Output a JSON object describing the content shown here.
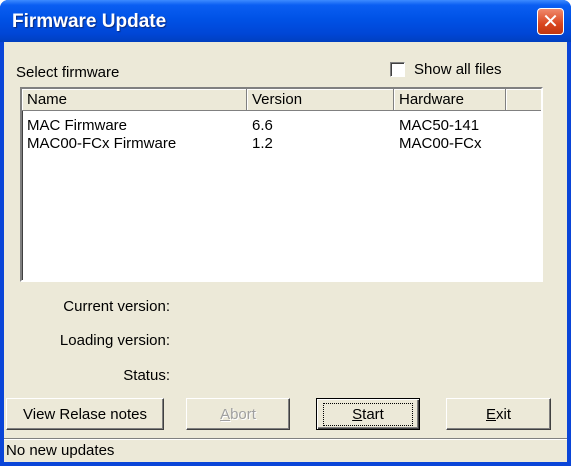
{
  "window": {
    "title": "Firmware Update",
    "close_glyph": "✕"
  },
  "select_firmware_label": "Select firmware",
  "show_all_files": {
    "label": "Show all files",
    "checked": false
  },
  "firmware_list": {
    "columns": [
      "Name",
      "Version",
      "Hardware",
      ""
    ],
    "rows": [
      {
        "name": "MAC Firmware",
        "version": "6.6",
        "hardware": "MAC50-141"
      },
      {
        "name": "MAC00-FCx Firmware",
        "version": "1.2",
        "hardware": "MAC00-FCx"
      }
    ]
  },
  "info": {
    "current_version_label": "Current version:",
    "loading_version_label": "Loading version:",
    "status_label": "Status:"
  },
  "buttons": {
    "release_notes": "View Relase notes",
    "abort_accel": "A",
    "abort_rest": "bort",
    "start_accel": "S",
    "start_rest": "tart",
    "exit_accel": "E",
    "exit_rest": "xit"
  },
  "status_bar": {
    "text": "No new updates"
  },
  "colors": {
    "title_bar": "#0052e6",
    "close_button": "#d9451f",
    "dialog_face": "#ece9d8"
  }
}
